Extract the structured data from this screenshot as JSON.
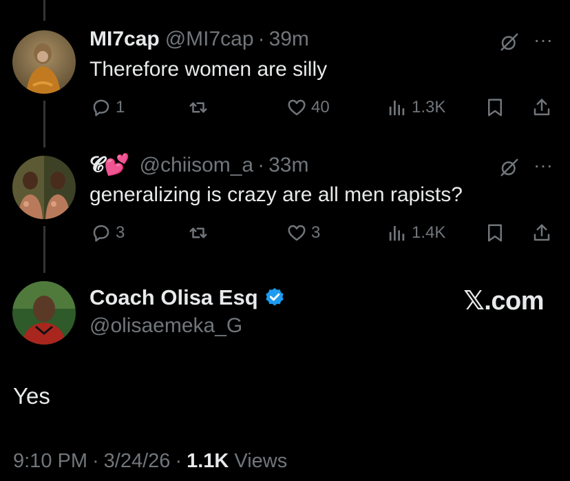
{
  "replies": [
    {
      "name": "MI7cap",
      "handle": "@MI7cap",
      "separator": "·",
      "time": "39m",
      "text": "Therefore women are silly",
      "stats": {
        "replies": "1",
        "reposts": "",
        "likes": "40",
        "views": "1.3K"
      }
    },
    {
      "name": "𝓒💕",
      "handle": "@chiisom_a",
      "separator": "·",
      "time": "33m",
      "text": "generalizing is crazy are all men rapists?",
      "stats": {
        "replies": "3",
        "reposts": "",
        "likes": "3",
        "views": "1.4K"
      }
    }
  ],
  "main": {
    "name": "Coach Olisa Esq",
    "handle": "@olisaemeka_G",
    "text": "Yes",
    "time": "9:10 PM",
    "date": "3/24/26",
    "sep": "·",
    "views_count": "1.1K",
    "views_label": "Views",
    "verified_color": "#1d9bf0"
  },
  "watermark": "𝕏.com",
  "colors": {
    "background": "#000000",
    "text": "#e7e9ea",
    "muted": "#71767b",
    "accent": "#1d9bf0"
  },
  "icons": [
    "reply-icon",
    "repost-icon",
    "like-icon",
    "views-icon",
    "bookmark-icon",
    "share-icon",
    "grok-icon",
    "more-icon",
    "verified-badge-icon"
  ]
}
